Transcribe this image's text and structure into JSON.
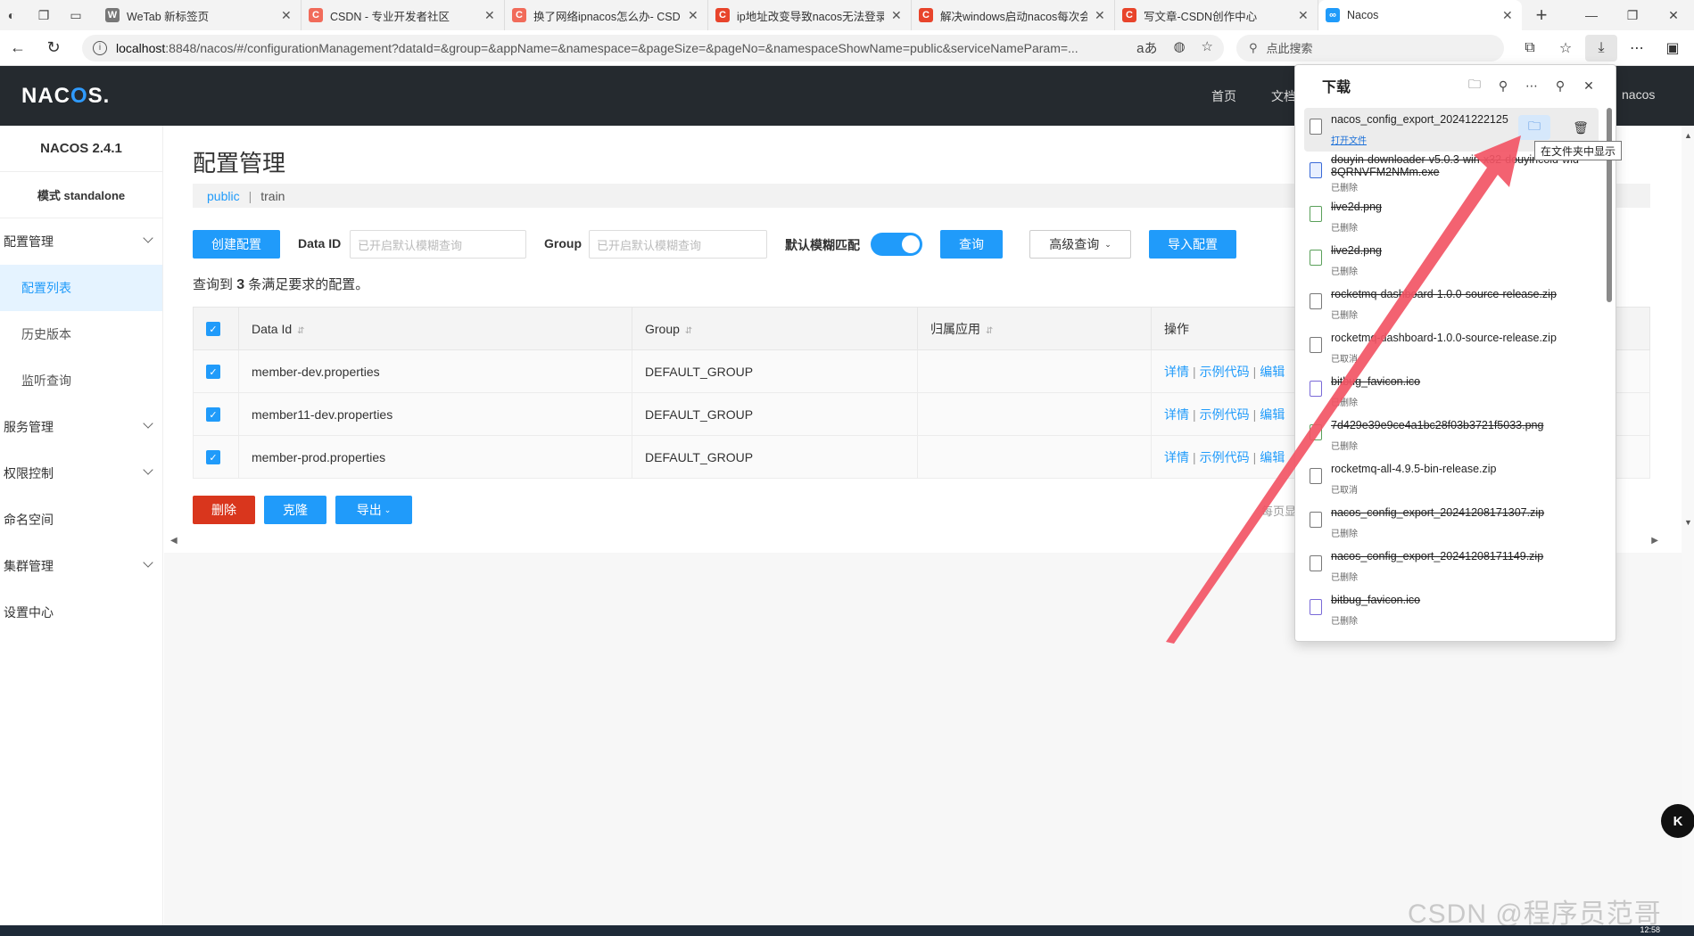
{
  "browser": {
    "tabs": [
      {
        "title": "WeTab 新标签页",
        "favicon_color": "#777777",
        "favicon_glyph": "W"
      },
      {
        "title": "CSDN - 专业开发者社区",
        "favicon_color": "#f16b5a",
        "favicon_glyph": "C"
      },
      {
        "title": "换了网络ipnacos怎么办- CSDN",
        "favicon_color": "#f16b5a",
        "favicon_glyph": "C"
      },
      {
        "title": "ip地址改变导致nacos无法登录",
        "favicon_color": "#e8442b",
        "favicon_glyph": "C"
      },
      {
        "title": "解决windows启动nacos每次会",
        "favicon_color": "#e8442b",
        "favicon_glyph": "C"
      },
      {
        "title": "写文章-CSDN创作中心",
        "favicon_color": "#e8442b",
        "favicon_glyph": "C"
      },
      {
        "title": "Nacos",
        "favicon_color": "#209bfa",
        "favicon_glyph": "∞"
      }
    ],
    "url_host": "localhost",
    "url_rest": ":8848/nacos/#/configurationManagement?dataId=&group=&appName=&namespace=&pageSize=&pageNo=&namespaceShowName=public&serviceNameParam=...",
    "search_placeholder": "点此搜索"
  },
  "nacos": {
    "logo": "NACOS.",
    "nav": [
      "首页",
      "文档"
    ],
    "user": "nacos",
    "version": "NACOS 2.4.1",
    "mode": "模式 standalone"
  },
  "sidebar": {
    "config_mgmt": "配置管理",
    "config_list": "配置列表",
    "history": "历史版本",
    "listen_query": "监听查询",
    "service_mgmt": "服务管理",
    "auth_control": "权限控制",
    "namespace": "命名空间",
    "cluster_mgmt": "集群管理",
    "settings": "设置中心"
  },
  "page": {
    "title": "配置管理",
    "namespace_public": "public",
    "namespace_sep": "|",
    "namespace_train": "train",
    "create_btn": "创建配置",
    "dataid_label": "Data ID",
    "dataid_placeholder": "已开启默认模糊查询",
    "group_label": "Group",
    "group_placeholder": "已开启默认模糊查询",
    "fuzzy_label": "默认模糊匹配",
    "fuzzy_enabled": true,
    "query_btn": "查询",
    "advanced_btn": "高级查询",
    "import_btn": "导入配置",
    "result_prefix": "查询到",
    "result_count": "3",
    "result_suffix": "条满足要求的配置。",
    "delete_btn": "删除",
    "clone_btn": "克隆",
    "export_btn": "导出",
    "per_page": "每页显"
  },
  "table": {
    "headers": [
      "Data Id",
      "Group",
      "归属应用",
      "操作"
    ],
    "rows": [
      {
        "data_id": "member-dev.properties",
        "group": "DEFAULT_GROUP",
        "app": ""
      },
      {
        "data_id": "member11-dev.properties",
        "group": "DEFAULT_GROUP",
        "app": ""
      },
      {
        "data_id": "member-prod.properties",
        "group": "DEFAULT_GROUP",
        "app": ""
      }
    ],
    "actions": [
      "详情",
      "示例代码",
      "编辑"
    ]
  },
  "downloads": {
    "title": "下载",
    "tooltip": "在文件夹中显示",
    "items": [
      {
        "name": "nacos_config_export_20241222125",
        "status": "打开文件",
        "deleted": false,
        "kind": "zip"
      },
      {
        "name": "douyin-downloader-v5.0.3-win-x32-douyincold-wid-8QRNVFM2NMm.exe",
        "status": "已删除",
        "deleted": true,
        "kind": "exe"
      },
      {
        "name": "live2d.png",
        "status": "已删除",
        "deleted": true,
        "kind": "img"
      },
      {
        "name": "live2d.png",
        "status": "已删除",
        "deleted": true,
        "kind": "img"
      },
      {
        "name": "rocketmq-dashboard-1.0.0-source-release.zip",
        "status": "已删除",
        "deleted": true,
        "kind": "zip"
      },
      {
        "name": "rocketmq-dashboard-1.0.0-source-release.zip",
        "status": "已取消",
        "deleted": false,
        "kind": "zip"
      },
      {
        "name": "bitbug_favicon.ico",
        "status": "已删除",
        "deleted": true,
        "kind": "ico"
      },
      {
        "name": "7d429e39e9ce4a1bc28f03b3721f5033.png",
        "status": "已删除",
        "deleted": true,
        "kind": "img"
      },
      {
        "name": "rocketmq-all-4.9.5-bin-release.zip",
        "status": "已取消",
        "deleted": false,
        "kind": "zip"
      },
      {
        "name": "nacos_config_export_20241208171307.zip",
        "status": "已删除",
        "deleted": true,
        "kind": "zip"
      },
      {
        "name": "nacos_config_export_20241208171149.zip",
        "status": "已删除",
        "deleted": true,
        "kind": "zip"
      },
      {
        "name": "bitbug_favicon.ico",
        "status": "已删除",
        "deleted": true,
        "kind": "ico"
      }
    ]
  },
  "watermark": "CSDN @程序员范哥",
  "taskbar_clock": "12:58"
}
